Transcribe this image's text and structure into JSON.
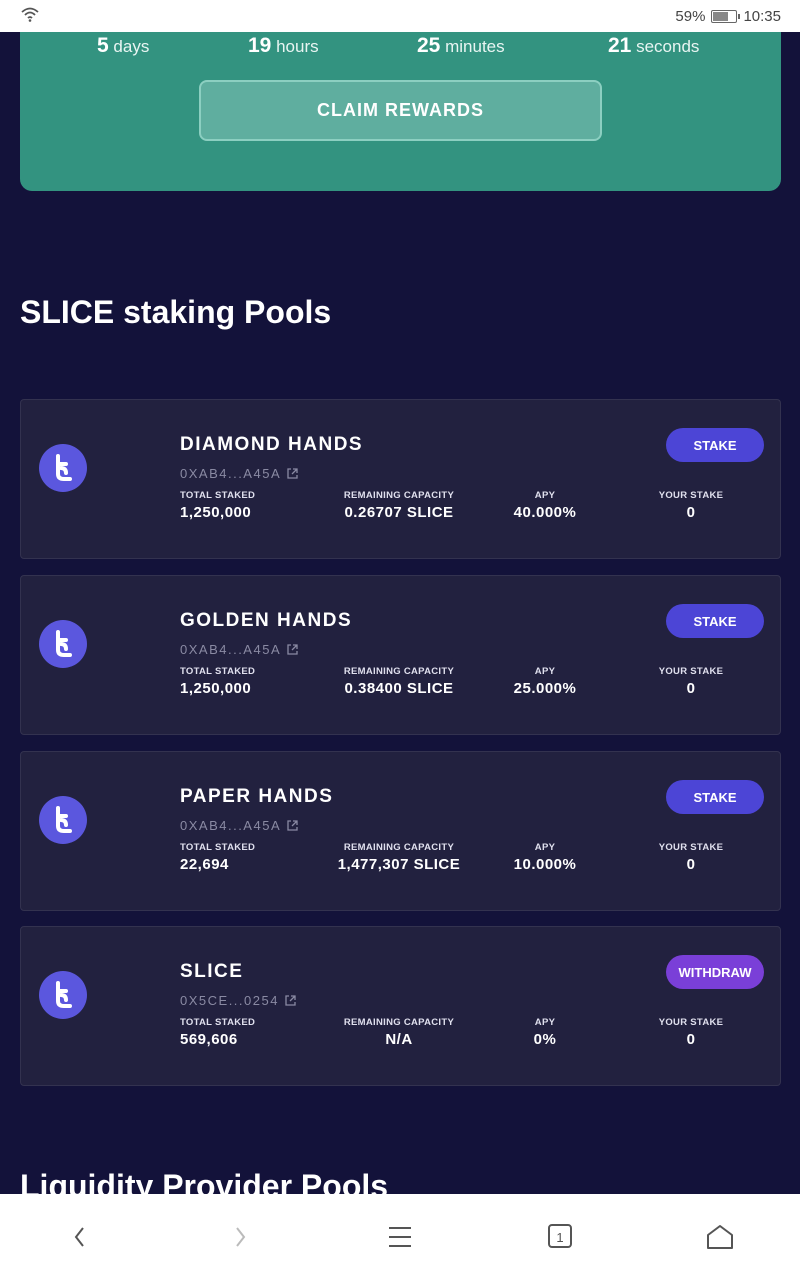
{
  "status_bar": {
    "battery_percent": "59%",
    "battery_level": 0.59,
    "time": "10:35"
  },
  "countdown": [
    {
      "value": "5",
      "unit": "days"
    },
    {
      "value": "19",
      "unit": "hours"
    },
    {
      "value": "25",
      "unit": "minutes"
    },
    {
      "value": "21",
      "unit": "seconds"
    }
  ],
  "claim_button": "CLAIM REWARDS",
  "staking_section_title": "SLICE staking Pools",
  "stat_labels": {
    "total_staked": "TOTAL STAKED",
    "remaining_capacity": "REMAINING CAPACITY",
    "apy": "APY",
    "your_stake": "YOUR STAKE"
  },
  "pools": [
    {
      "name": "DIAMOND HANDS",
      "address": "0XAB4...A45A",
      "button": "STAKE",
      "total_staked": "1,250,000",
      "remaining_capacity": "0.26707 SLICE",
      "apy": "40.000%",
      "your_stake": "0"
    },
    {
      "name": "GOLDEN HANDS",
      "address": "0XAB4...A45A",
      "button": "STAKE",
      "total_staked": "1,250,000",
      "remaining_capacity": "0.38400 SLICE",
      "apy": "25.000%",
      "your_stake": "0"
    },
    {
      "name": "PAPER HANDS",
      "address": "0XAB4...A45A",
      "button": "STAKE",
      "total_staked": "22,694",
      "remaining_capacity": "1,477,307 SLICE",
      "apy": "10.000%",
      "your_stake": "0"
    },
    {
      "name": "SLICE",
      "address": "0X5CE...0254",
      "button": "WITHDRAW",
      "total_staked": "569,606",
      "remaining_capacity": "N/A",
      "apy": "0%",
      "your_stake": "0"
    }
  ],
  "liquidity_section_title": "Liquidity Provider Pools",
  "colors": {
    "background": "#13123a",
    "card": "#22213f",
    "reward_card": "#339380",
    "stake_button": "#4c45d6",
    "withdraw_button": "#7a3fd8",
    "pool_icon": "#5b57de"
  },
  "icons": [
    "wifi-icon",
    "battery-icon",
    "pool-logo-icon",
    "external-link-icon",
    "back-icon",
    "forward-icon",
    "menu-icon",
    "tabs-icon",
    "home-icon"
  ]
}
